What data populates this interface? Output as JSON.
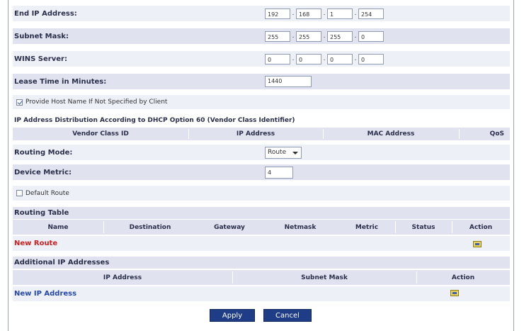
{
  "end_ip": {
    "label": "End IP Address:",
    "octets": [
      "192",
      "168",
      "1",
      "254"
    ]
  },
  "subnet_mask": {
    "label": "Subnet Mask:",
    "octets": [
      "255",
      "255",
      "255",
      "0"
    ]
  },
  "wins_server": {
    "label": "WINS Server:",
    "octets": [
      "0",
      "0",
      "0",
      "0"
    ]
  },
  "lease_time": {
    "label": "Lease Time in Minutes:",
    "value": "1440"
  },
  "provide_host_name": {
    "label": "Provide Host Name If Not Specified by Client",
    "checked": true
  },
  "dhcp_option60": {
    "title": "IP Address Distribution According to DHCP Option 60 (Vendor Class Identifier)",
    "columns": [
      "Vendor Class ID",
      "IP Address",
      "MAC Address",
      "QoS"
    ]
  },
  "routing_mode": {
    "label": "Routing Mode:",
    "selected": "Route"
  },
  "device_metric": {
    "label": "Device Metric:",
    "value": "4"
  },
  "default_route": {
    "label": "Default Route",
    "checked": false
  },
  "routing_table": {
    "title": "Routing Table",
    "columns": [
      "Name",
      "Destination",
      "Gateway",
      "Netmask",
      "Metric",
      "Status",
      "Action"
    ],
    "new_link": "New Route"
  },
  "additional_ip": {
    "title": "Additional IP Addresses",
    "columns": [
      "IP Address",
      "Subnet Mask",
      "Action"
    ],
    "new_link": "New IP Address"
  },
  "buttons": {
    "apply": "Apply",
    "cancel": "Cancel"
  },
  "colors": {
    "accent": "#1f3d86",
    "link_red": "#cc1f1f",
    "link_blue": "#2448a8",
    "row_shade": "#e0e3ef"
  },
  "icons": {
    "edit": "edit-icon",
    "dropdown": "chevron-down-icon"
  }
}
